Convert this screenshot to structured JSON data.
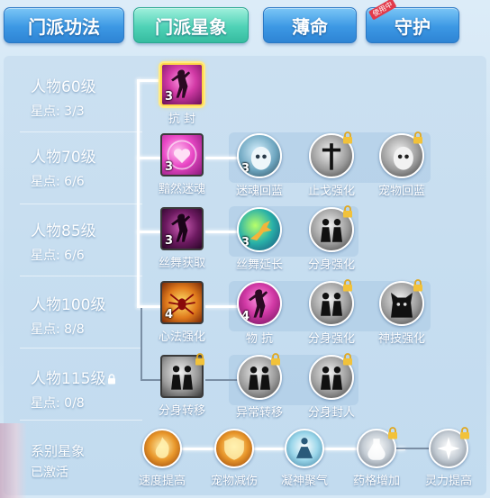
{
  "tabs": [
    {
      "label": "门派功法",
      "style": "blue"
    },
    {
      "label": "门派星象",
      "style": "teal",
      "active": true
    },
    {
      "label": "薄命",
      "style": "blue"
    },
    {
      "label": "守护",
      "style": "blue",
      "badge": "使用中"
    }
  ],
  "rows": [
    {
      "level": "人物60级",
      "points": "星点: 3/3",
      "locked": false
    },
    {
      "level": "人物70级",
      "points": "星点: 6/6",
      "locked": false
    },
    {
      "level": "人物85级",
      "points": "星点: 6/6",
      "locked": false
    },
    {
      "level": "人物100级",
      "points": "星点: 8/8",
      "locked": false
    },
    {
      "level": "人物115级",
      "points": "星点: 0/8",
      "locked": true
    }
  ],
  "nodes": {
    "r0": [
      {
        "label": "抗 封",
        "count": "3",
        "icon": "dancer-icon"
      }
    ],
    "r1": [
      {
        "label": "黯然迷魂",
        "count": "3",
        "icon": "heart-swirl-icon"
      },
      {
        "label": "迷魂回蓝",
        "count": "3",
        "icon": "ghost-face-icon"
      },
      {
        "label": "止戈强化",
        "count": "",
        "icon": "sword-icon",
        "locked": true
      },
      {
        "label": "宠物回蓝",
        "count": "",
        "icon": "ghost-face-icon",
        "locked": true
      }
    ],
    "r2": [
      {
        "label": "丝舞获取",
        "count": "3",
        "icon": "dancer-icon"
      },
      {
        "label": "丝舞延长",
        "count": "3",
        "icon": "fighter-icon"
      },
      {
        "label": "分身强化",
        "count": "",
        "icon": "clone-icon",
        "locked": true
      }
    ],
    "r3": [
      {
        "label": "心法强化",
        "count": "4",
        "icon": "spider-icon"
      },
      {
        "label": "物 抗",
        "count": "4",
        "icon": "dancer-icon"
      },
      {
        "label": "分身强化",
        "count": "",
        "icon": "clone-icon",
        "locked": true
      },
      {
        "label": "神技强化",
        "count": "",
        "icon": "demon-icon",
        "locked": true
      }
    ],
    "r4": [
      {
        "label": "分身转移",
        "count": "",
        "icon": "clone-icon",
        "locked": true
      },
      {
        "label": "异常转移",
        "count": "",
        "icon": "clone-icon",
        "locked": true
      },
      {
        "label": "分身封人",
        "count": "",
        "icon": "clone-icon",
        "locked": true
      }
    ]
  },
  "system": {
    "title": "系别星象",
    "status": "已激活",
    "items": [
      {
        "label": "速度提高",
        "icon": "fire-burst-icon"
      },
      {
        "label": "宠物减伤",
        "icon": "paw-shield-icon"
      },
      {
        "label": "凝神聚气",
        "icon": "meditation-icon"
      },
      {
        "label": "药格增加",
        "icon": "potion-icon",
        "locked": true
      },
      {
        "label": "灵力提高",
        "icon": "sparkle-icon",
        "locked": true
      }
    ]
  }
}
